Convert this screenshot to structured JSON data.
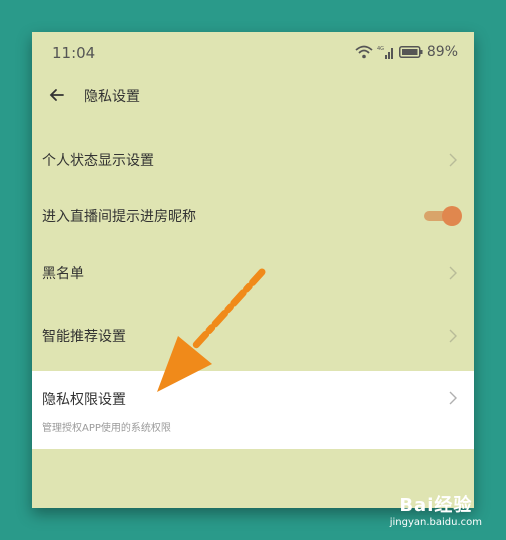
{
  "status_bar": {
    "time": "11:04",
    "battery": "89%"
  },
  "header": {
    "title": "隐私设置"
  },
  "rows": [
    {
      "label": "个人状态显示设置"
    },
    {
      "label": "进入直播间提示进房昵称",
      "toggle_on": true
    },
    {
      "label": "黑名单"
    },
    {
      "label": "智能推荐设置"
    },
    {
      "label": "隐私权限设置",
      "sub": "管理授权APP使用的系统权限"
    }
  ],
  "colors": {
    "accent": "#e0874e",
    "screen_bg": "#dfe4b2",
    "page_bg": "#2a9a8a",
    "arrow": "#f08a1a"
  },
  "watermark": {
    "line1": "Bai经验",
    "line2": "jingyan.baidu.com"
  }
}
